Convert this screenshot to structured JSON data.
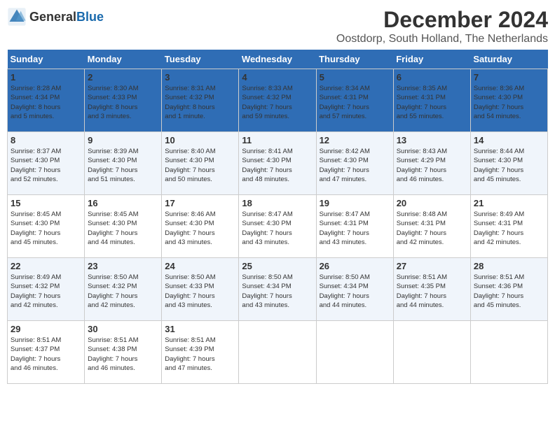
{
  "logo": {
    "general": "General",
    "blue": "Blue"
  },
  "title": {
    "month": "December 2024",
    "location": "Oostdorp, South Holland, The Netherlands"
  },
  "headers": [
    "Sunday",
    "Monday",
    "Tuesday",
    "Wednesday",
    "Thursday",
    "Friday",
    "Saturday"
  ],
  "weeks": [
    [
      {
        "day": "1",
        "lines": [
          "Sunrise: 8:28 AM",
          "Sunset: 4:34 PM",
          "Daylight: 8 hours",
          "and 5 minutes."
        ]
      },
      {
        "day": "2",
        "lines": [
          "Sunrise: 8:30 AM",
          "Sunset: 4:33 PM",
          "Daylight: 8 hours",
          "and 3 minutes."
        ]
      },
      {
        "day": "3",
        "lines": [
          "Sunrise: 8:31 AM",
          "Sunset: 4:32 PM",
          "Daylight: 8 hours",
          "and 1 minute."
        ]
      },
      {
        "day": "4",
        "lines": [
          "Sunrise: 8:33 AM",
          "Sunset: 4:32 PM",
          "Daylight: 7 hours",
          "and 59 minutes."
        ]
      },
      {
        "day": "5",
        "lines": [
          "Sunrise: 8:34 AM",
          "Sunset: 4:31 PM",
          "Daylight: 7 hours",
          "and 57 minutes."
        ]
      },
      {
        "day": "6",
        "lines": [
          "Sunrise: 8:35 AM",
          "Sunset: 4:31 PM",
          "Daylight: 7 hours",
          "and 55 minutes."
        ]
      },
      {
        "day": "7",
        "lines": [
          "Sunrise: 8:36 AM",
          "Sunset: 4:30 PM",
          "Daylight: 7 hours",
          "and 54 minutes."
        ]
      }
    ],
    [
      {
        "day": "8",
        "lines": [
          "Sunrise: 8:37 AM",
          "Sunset: 4:30 PM",
          "Daylight: 7 hours",
          "and 52 minutes."
        ]
      },
      {
        "day": "9",
        "lines": [
          "Sunrise: 8:39 AM",
          "Sunset: 4:30 PM",
          "Daylight: 7 hours",
          "and 51 minutes."
        ]
      },
      {
        "day": "10",
        "lines": [
          "Sunrise: 8:40 AM",
          "Sunset: 4:30 PM",
          "Daylight: 7 hours",
          "and 50 minutes."
        ]
      },
      {
        "day": "11",
        "lines": [
          "Sunrise: 8:41 AM",
          "Sunset: 4:30 PM",
          "Daylight: 7 hours",
          "and 48 minutes."
        ]
      },
      {
        "day": "12",
        "lines": [
          "Sunrise: 8:42 AM",
          "Sunset: 4:30 PM",
          "Daylight: 7 hours",
          "and 47 minutes."
        ]
      },
      {
        "day": "13",
        "lines": [
          "Sunrise: 8:43 AM",
          "Sunset: 4:29 PM",
          "Daylight: 7 hours",
          "and 46 minutes."
        ]
      },
      {
        "day": "14",
        "lines": [
          "Sunrise: 8:44 AM",
          "Sunset: 4:30 PM",
          "Daylight: 7 hours",
          "and 45 minutes."
        ]
      }
    ],
    [
      {
        "day": "15",
        "lines": [
          "Sunrise: 8:45 AM",
          "Sunset: 4:30 PM",
          "Daylight: 7 hours",
          "and 45 minutes."
        ]
      },
      {
        "day": "16",
        "lines": [
          "Sunrise: 8:45 AM",
          "Sunset: 4:30 PM",
          "Daylight: 7 hours",
          "and 44 minutes."
        ]
      },
      {
        "day": "17",
        "lines": [
          "Sunrise: 8:46 AM",
          "Sunset: 4:30 PM",
          "Daylight: 7 hours",
          "and 43 minutes."
        ]
      },
      {
        "day": "18",
        "lines": [
          "Sunrise: 8:47 AM",
          "Sunset: 4:30 PM",
          "Daylight: 7 hours",
          "and 43 minutes."
        ]
      },
      {
        "day": "19",
        "lines": [
          "Sunrise: 8:47 AM",
          "Sunset: 4:31 PM",
          "Daylight: 7 hours",
          "and 43 minutes."
        ]
      },
      {
        "day": "20",
        "lines": [
          "Sunrise: 8:48 AM",
          "Sunset: 4:31 PM",
          "Daylight: 7 hours",
          "and 42 minutes."
        ]
      },
      {
        "day": "21",
        "lines": [
          "Sunrise: 8:49 AM",
          "Sunset: 4:31 PM",
          "Daylight: 7 hours",
          "and 42 minutes."
        ]
      }
    ],
    [
      {
        "day": "22",
        "lines": [
          "Sunrise: 8:49 AM",
          "Sunset: 4:32 PM",
          "Daylight: 7 hours",
          "and 42 minutes."
        ]
      },
      {
        "day": "23",
        "lines": [
          "Sunrise: 8:50 AM",
          "Sunset: 4:32 PM",
          "Daylight: 7 hours",
          "and 42 minutes."
        ]
      },
      {
        "day": "24",
        "lines": [
          "Sunrise: 8:50 AM",
          "Sunset: 4:33 PM",
          "Daylight: 7 hours",
          "and 43 minutes."
        ]
      },
      {
        "day": "25",
        "lines": [
          "Sunrise: 8:50 AM",
          "Sunset: 4:34 PM",
          "Daylight: 7 hours",
          "and 43 minutes."
        ]
      },
      {
        "day": "26",
        "lines": [
          "Sunrise: 8:50 AM",
          "Sunset: 4:34 PM",
          "Daylight: 7 hours",
          "and 44 minutes."
        ]
      },
      {
        "day": "27",
        "lines": [
          "Sunrise: 8:51 AM",
          "Sunset: 4:35 PM",
          "Daylight: 7 hours",
          "and 44 minutes."
        ]
      },
      {
        "day": "28",
        "lines": [
          "Sunrise: 8:51 AM",
          "Sunset: 4:36 PM",
          "Daylight: 7 hours",
          "and 45 minutes."
        ]
      }
    ],
    [
      {
        "day": "29",
        "lines": [
          "Sunrise: 8:51 AM",
          "Sunset: 4:37 PM",
          "Daylight: 7 hours",
          "and 46 minutes."
        ]
      },
      {
        "day": "30",
        "lines": [
          "Sunrise: 8:51 AM",
          "Sunset: 4:38 PM",
          "Daylight: 7 hours",
          "and 46 minutes."
        ]
      },
      {
        "day": "31",
        "lines": [
          "Sunrise: 8:51 AM",
          "Sunset: 4:39 PM",
          "Daylight: 7 hours",
          "and 47 minutes."
        ]
      },
      null,
      null,
      null,
      null
    ]
  ]
}
